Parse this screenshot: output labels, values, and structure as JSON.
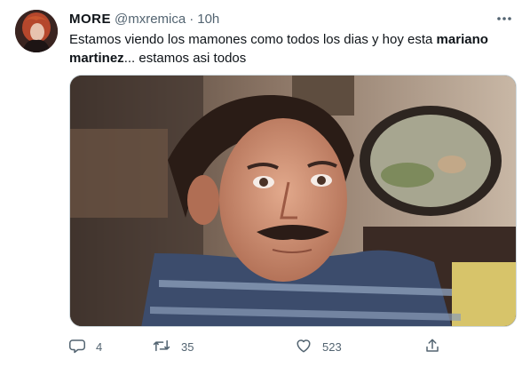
{
  "tweet": {
    "author": {
      "name": "MORE",
      "handle": "@mxremica",
      "separator": "·",
      "time": "10h",
      "avatar": "profile-photo"
    },
    "text_plain_1": "Estamos viendo los mamones como todos los dias y hoy esta ",
    "text_bold": "mariano martinez",
    "text_plain_2": "... estamos asi todos",
    "media": "meme-image-man-surprised-face",
    "actions": {
      "replies": "4",
      "retweets": "35",
      "likes": "523"
    },
    "icons": {
      "more": "more-horizontal-icon",
      "reply": "reply-icon",
      "retweet": "retweet-icon",
      "like": "heart-icon",
      "share": "share-icon"
    },
    "colors": {
      "text": "#0f1419",
      "secondary": "#536471",
      "border": "#cfd9de"
    }
  }
}
